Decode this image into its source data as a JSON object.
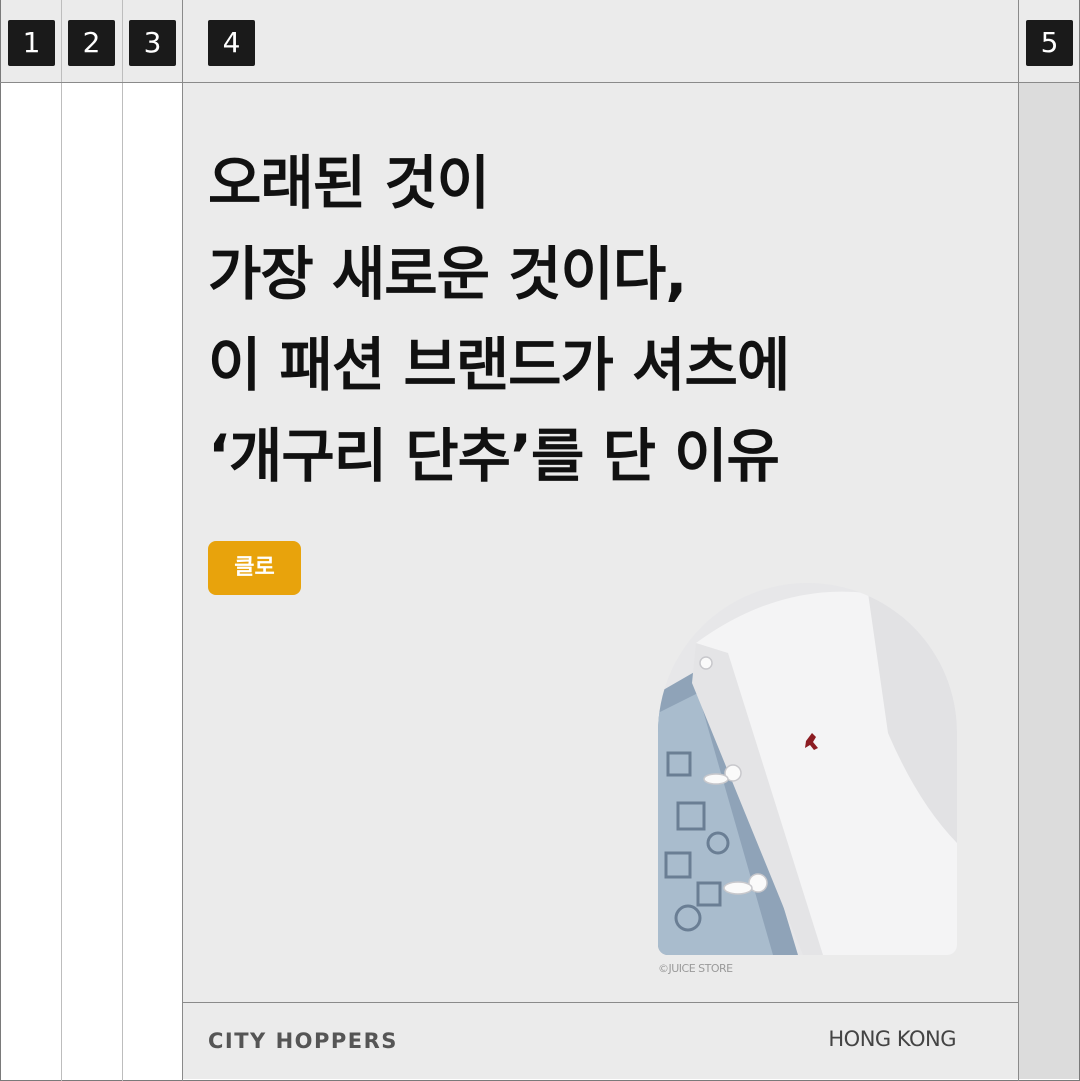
{
  "tabs": [
    "1",
    "2",
    "3",
    "4",
    "5"
  ],
  "headline": {
    "line1": "오래된 것이",
    "line2": "가장 새로운 것이다,",
    "line3": "이 패션 브랜드가 셔츠에",
    "line4": "‘개구리 단추’를 단 이유"
  },
  "tag": "클로",
  "photo": {
    "subject": "white shirt with frog buttons",
    "credit": "©JUICE STORE"
  },
  "footer": {
    "logo": "CITY HOPPERS",
    "location": "HONG KONG"
  },
  "colors": {
    "accent": "#e8a30c",
    "background": "#ebebeb",
    "text": "#111111"
  }
}
